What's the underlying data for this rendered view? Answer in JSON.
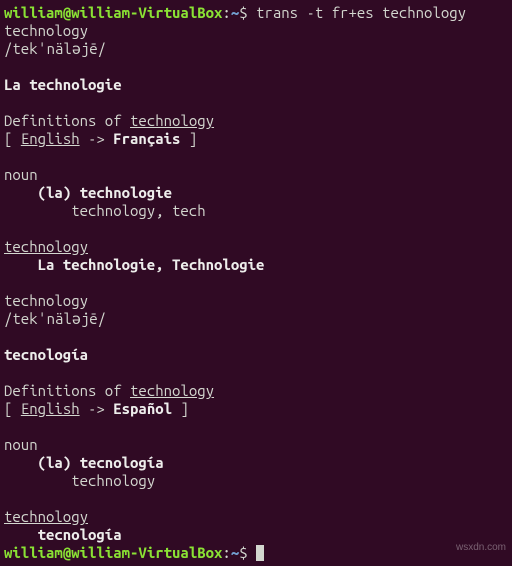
{
  "prompt1": {
    "user": "william",
    "at": "@",
    "host": "william-VirtualBox",
    "colon": ":",
    "path": "~",
    "dollar": "$",
    "command": " trans -t fr+es technology"
  },
  "block1": {
    "word": "technology",
    "phonetic": "/tekˈnäləjē/",
    "blank": " ",
    "translation": "La technologie",
    "defs_of": "Definitions of ",
    "defs_word": "technology",
    "lb": "[ ",
    "src_lang": "English",
    "arrow": " -> ",
    "dst_lang": "Français",
    "rb": " ]",
    "pos": "noun",
    "entry_indent": "    ",
    "entry": "(la) technologie",
    "gloss_indent": "        ",
    "gloss": "technology, tech",
    "word2": "technology",
    "trans_indent": "    ",
    "trans_list1": "La technologie",
    "trans_comma": ", ",
    "trans_list2": "Technologie"
  },
  "block2": {
    "word": "technology",
    "phonetic": "/tekˈnäləjē/",
    "blank": " ",
    "translation": "tecnología",
    "defs_of": "Definitions of ",
    "defs_word": "technology",
    "lb": "[ ",
    "src_lang": "English",
    "arrow": " -> ",
    "dst_lang": "Español",
    "rb": " ]",
    "pos": "noun",
    "entry_indent": "    ",
    "entry": "(la) tecnología",
    "gloss_indent": "        ",
    "gloss": "technology",
    "word2": "technology",
    "trans_indent": "    ",
    "trans_list1": "tecnología"
  },
  "prompt2": {
    "user": "william",
    "at": "@",
    "host": "william-VirtualBox",
    "colon": ":",
    "path": "~",
    "dollar": "$",
    "space": " "
  },
  "watermark": "wsxdn.com"
}
